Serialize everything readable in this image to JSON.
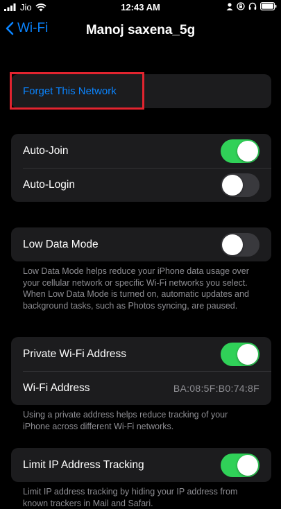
{
  "status_bar": {
    "carrier": "Jio",
    "time": "12:43 AM"
  },
  "nav": {
    "back_label": "Wi-Fi",
    "title": "Manoj saxena_5g"
  },
  "forget_network": {
    "label": "Forget This Network"
  },
  "auto_join": {
    "label": "Auto-Join",
    "on": true
  },
  "auto_login": {
    "label": "Auto-Login",
    "on": false
  },
  "low_data_mode": {
    "label": "Low Data Mode",
    "on": false,
    "note": "Low Data Mode helps reduce your iPhone data usage over your cellular network or specific Wi-Fi networks you select. When Low Data Mode is turned on, automatic updates and background tasks, such as Photos syncing, are paused."
  },
  "private_address": {
    "label": "Private Wi-Fi Address",
    "on": true,
    "address_label": "Wi-Fi Address",
    "address_value": "BA:08:5F:B0:74:8F",
    "note": "Using a private address helps reduce tracking of your iPhone across different Wi-Fi networks."
  },
  "limit_ip": {
    "label": "Limit IP Address Tracking",
    "on": true,
    "note": "Limit IP address tracking by hiding your IP address from known trackers in Mail and Safari."
  },
  "colors": {
    "accent": "#0a84ff",
    "toggle_on": "#30d158",
    "highlight": "#e2242f"
  }
}
